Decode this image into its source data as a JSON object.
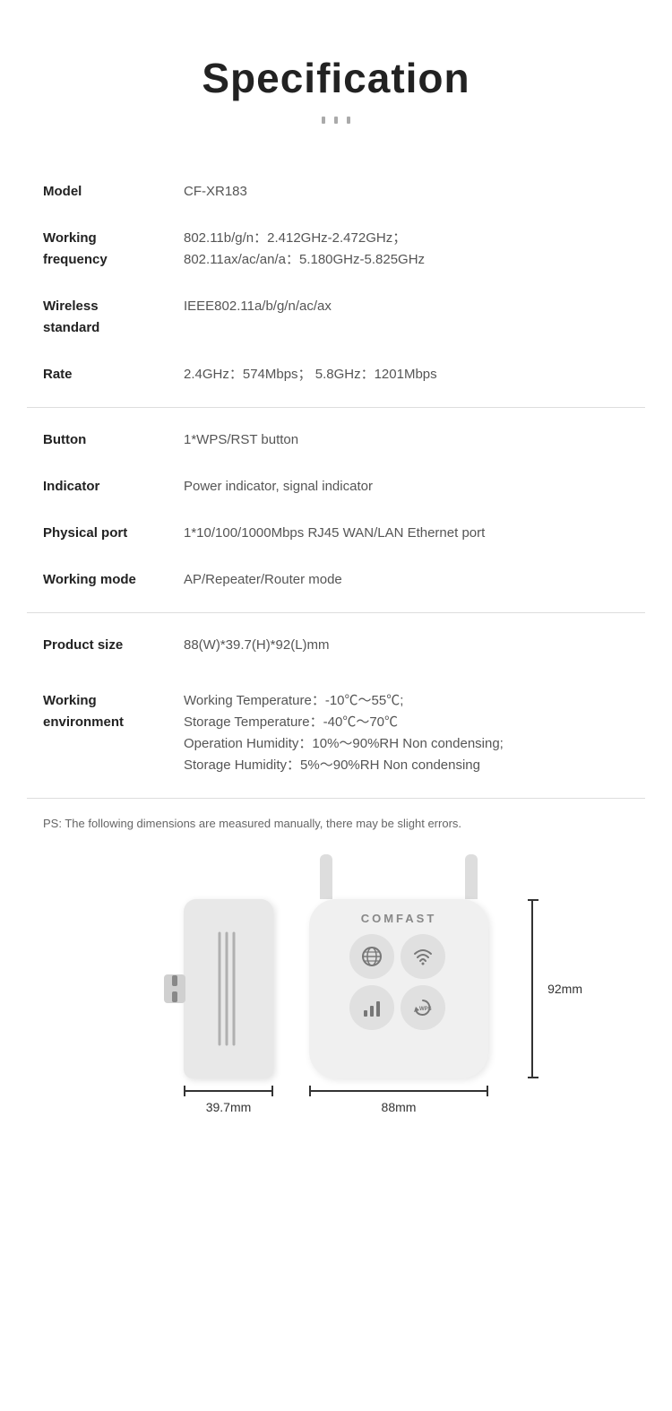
{
  "page": {
    "title": "Specification",
    "title_icon": "|||",
    "ps_note": "PS: The following dimensions are measured manually, there may be slight errors."
  },
  "specs": [
    {
      "label": "Model",
      "value": "CF-XR183"
    },
    {
      "label": "Working frequency",
      "value": "802.11b/g/n：2.412GHz-2.472GHz；\n802.11ax/ac/an/a：5.180GHz-5.825GHz"
    },
    {
      "label": "Wireless standard",
      "value": "IEEE802.11a/b/g/n/ac/ax"
    },
    {
      "label": "Rate",
      "value": "2.4GHz：574Mbps；  5.8GHz：1201Mbps"
    }
  ],
  "specs2": [
    {
      "label": "Button",
      "value": "1*WPS/RST button"
    },
    {
      "label": "Indicator",
      "value": "Power indicator, signal indicator"
    },
    {
      "label": "Physical port",
      "value": "1*10/100/1000Mbps RJ45 WAN/LAN Ethernet port"
    },
    {
      "label": "Working mode",
      "value": "AP/Repeater/Router mode"
    }
  ],
  "specs3": [
    {
      "label": "Product size",
      "value": "88(W)*39.7(H)*92(L)mm"
    }
  ],
  "specs4": [
    {
      "label": "Working environment",
      "value": "Working Temperature：-10℃～55℃;\nStorage Temperature：-40℃～70℃\nOperation Humidity：10%～90%RH Non condensing;\nStorage Humidity：5%～90%RH Non condensing"
    }
  ],
  "dimensions": {
    "width_label": "39.7mm",
    "front_label": "88mm",
    "height_label": "92mm"
  },
  "device2": {
    "brand": "COMFAST"
  }
}
